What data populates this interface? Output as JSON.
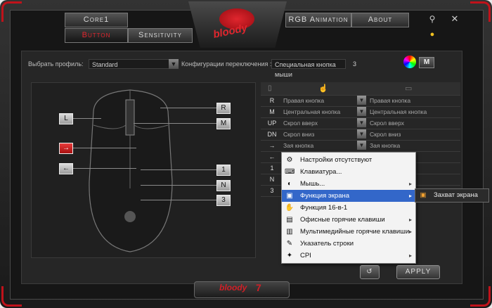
{
  "tabs": [
    {
      "label": "Core1",
      "active": false
    },
    {
      "label": "Button",
      "active": true
    },
    {
      "label": "Sensitivity",
      "active": false
    },
    {
      "label": "RGB Animation",
      "active": false
    },
    {
      "label": "About",
      "active": false
    }
  ],
  "logo_text": "bloody",
  "profile": {
    "label": "Выбрать профиль:",
    "value": "Standard"
  },
  "switch_config": {
    "label": "Конфигурации переключения :",
    "value": "Специальная кнопка мыши",
    "number": "3"
  },
  "m_button": "M",
  "mouse_keys": {
    "left": [
      "L",
      "→",
      "←"
    ],
    "right": [
      "R",
      "M",
      "1",
      "N",
      "3"
    ]
  },
  "table_rows": [
    {
      "code": "R",
      "name": "Правая кнопка",
      "value": "Правая кнопка"
    },
    {
      "code": "M",
      "name": "Центральная кнопка",
      "value": "Центральная кнопка"
    },
    {
      "code": "UP",
      "name": "Скрол вверх",
      "value": "Скрол вверх"
    },
    {
      "code": "DN",
      "name": "Скрол вниз",
      "value": "Скрол вниз"
    },
    {
      "code": "→",
      "name": "Зая кнопка",
      "value": "Зая кнопка"
    },
    {
      "code": "←",
      "name": "",
      "value": ""
    },
    {
      "code": "1",
      "name": "",
      "value": ""
    },
    {
      "code": "N",
      "name": "",
      "value": ""
    },
    {
      "code": "3",
      "name": "",
      "value": ""
    }
  ],
  "context_menu": [
    {
      "icon": "settings-icon",
      "glyph": "⚙",
      "label": "Настройки отсутствуют",
      "submenu": false,
      "highlighted": false
    },
    {
      "icon": "keyboard-icon",
      "glyph": "⌨",
      "label": "Клавиатура...",
      "submenu": false,
      "highlighted": false
    },
    {
      "icon": "mouse-icon",
      "glyph": "◐",
      "label": "Мышь...",
      "submenu": true,
      "highlighted": false
    },
    {
      "icon": "screen-function-icon",
      "glyph": "▣",
      "label": "Функция экрана",
      "submenu": true,
      "highlighted": true
    },
    {
      "icon": "hand-icon",
      "glyph": "✋",
      "label": "Функция 16-в-1",
      "submenu": false,
      "highlighted": false
    },
    {
      "icon": "office-hotkeys-icon",
      "glyph": "▤",
      "label": "Офисные горячие клавиши",
      "submenu": true,
      "highlighted": false
    },
    {
      "icon": "multimedia-hotkeys-icon",
      "glyph": "▥",
      "label": "Мультимедийные горячие клавиши",
      "submenu": true,
      "highlighted": false
    },
    {
      "icon": "line-pointer-icon",
      "glyph": "✎",
      "label": "Указатель строки",
      "submenu": false,
      "highlighted": false
    },
    {
      "icon": "cpi-icon",
      "glyph": "✦",
      "label": "CPI",
      "submenu": true,
      "highlighted": false
    }
  ],
  "submenu_item": {
    "icon": "screenshot-icon",
    "glyph": "▣",
    "label": "Захват экрана"
  },
  "apply_label": "APPLY",
  "footer": {
    "brand": "bloody",
    "number": "7"
  }
}
